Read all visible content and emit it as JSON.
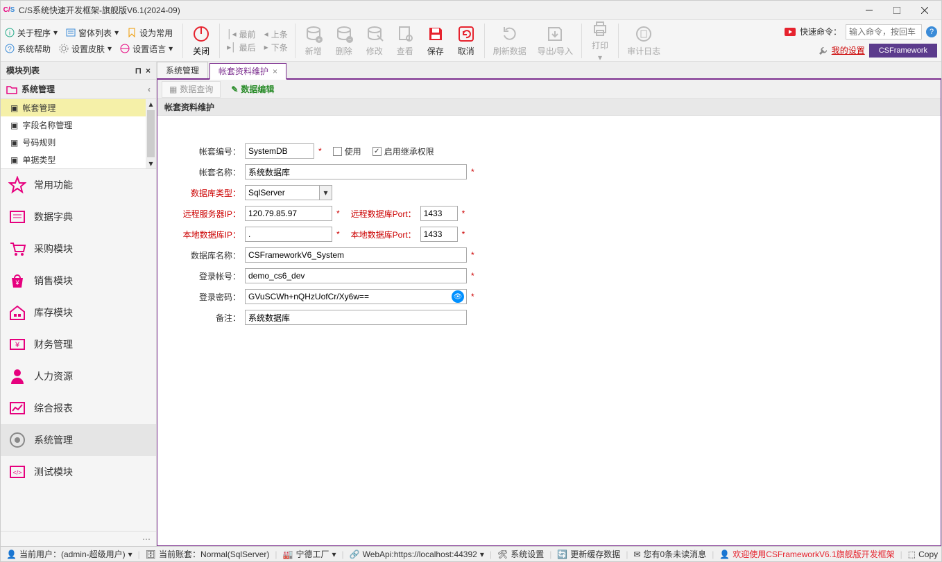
{
  "window": {
    "title": "C/S系统快速开发框架-旗舰版V6.1(2024-09)"
  },
  "menubar": {
    "about": "关于程序",
    "formList": "窗体列表",
    "setCommon": "设为常用",
    "sysHelp": "系统帮助",
    "setSkin": "设置皮肤",
    "setLang": "设置语言",
    "close": "关闭",
    "first": "最前",
    "prev": "上条",
    "last": "最后",
    "next": "下条",
    "add": "新增",
    "delete": "删除",
    "edit": "修改",
    "view": "查看",
    "save": "保存",
    "cancel": "取消",
    "refresh": "刷新数据",
    "export": "导出/导入",
    "print": "打印",
    "audit": "审计日志",
    "quickCmd": "快速命令：",
    "cmdPlaceholder": "输入命令，按回车",
    "mySettings": "我的设置",
    "brand": "CSFramework"
  },
  "sidebar": {
    "header": "模块列表",
    "section": "系统管理",
    "tree": [
      "帐套管理",
      "字段名称管理",
      "号码规则",
      "单据类型"
    ],
    "modules": [
      "常用功能",
      "数据字典",
      "采购模块",
      "销售模块",
      "库存模块",
      "财务管理",
      "人力资源",
      "综合报表",
      "系统管理",
      "测试模块"
    ]
  },
  "tabs": {
    "t1": "系统管理",
    "t2": "帐套资料维护"
  },
  "subtabs": {
    "query": "数据查询",
    "edit": "数据编辑"
  },
  "panel": {
    "title": "帐套资料维护"
  },
  "form": {
    "labels": {
      "acctNo": "帐套编号：",
      "use": "使用",
      "inherit": "启用继承权限",
      "acctName": "帐套名称：",
      "dbType": "数据库类型：",
      "remoteIp": "远程服务器IP：",
      "remotePort": "远程数据库Port：",
      "localIp": "本地数据库IP：",
      "localPort": "本地数据库Port：",
      "dbName": "数据库名称：",
      "login": "登录帐号：",
      "pwd": "登录密码：",
      "remark": "备注："
    },
    "values": {
      "acctNo": "SystemDB",
      "acctName": "系统数据库",
      "dbType": "SqlServer",
      "remoteIp": "120.79.85.97",
      "remotePort": "1433",
      "localIp": ".",
      "localPort": "1433",
      "dbName": "CSFrameworkV6_System",
      "login": "demo_cs6_dev",
      "pwd": "GVuSCWh+nQHzUofCr/Xy6w==",
      "remark": "系统数据库"
    }
  },
  "status": {
    "user": "当前用户：(admin-超级用户)",
    "acct": "当前账套：Normal(SqlServer)",
    "factory": "宁德工厂",
    "webapi": "WebApi:https://localhost:44392",
    "sysSet": "系统设置",
    "cache": "更新缓存数据",
    "msg": "您有0条未读消息",
    "welcome": "欢迎使用CSFrameworkV6.1旗舰版开发框架",
    "copy": "Copy"
  }
}
